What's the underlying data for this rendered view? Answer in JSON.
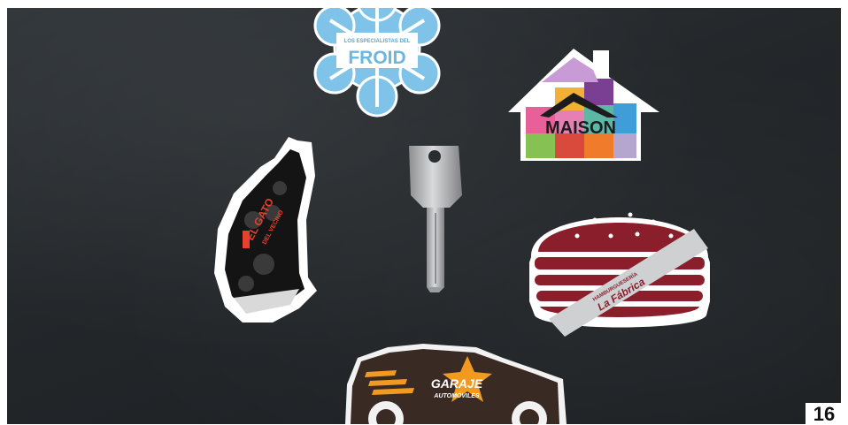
{
  "photo": {
    "snowflake_tagline": "LOS ESPECIALISTAS DEL",
    "snowflake_brand": "FROID",
    "house_brand": "MAISON",
    "cat_brand_line1": "EL GATO",
    "cat_brand_line2": "DEL VECINO",
    "burger_brand_line1": "HAMBURGUESERÍA",
    "burger_brand_line2": "La Fábrica",
    "car_brand_line1": "GARAJE",
    "car_brand_line2": "AUTOMÓVILES"
  },
  "page_number": "16",
  "colors": {
    "slate": "#23272a",
    "snowflake_blue": "#7fc4e8",
    "burger_red": "#8a1e2b",
    "car_orange": "#f29a1f",
    "cat_black": "#141414"
  }
}
